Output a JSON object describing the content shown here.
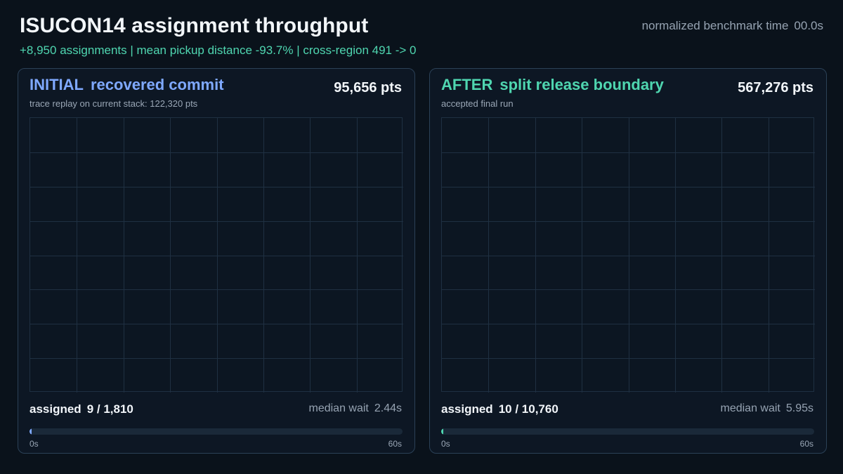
{
  "header": {
    "title": "ISUCON14 assignment throughput",
    "summary": "+8,950 assignments  |  mean pickup distance -93.7%  |  cross-region 491 -> 0",
    "bench_label": "normalized benchmark time",
    "bench_value": "00.0s"
  },
  "panels": {
    "initial": {
      "tag": "INITIAL",
      "name": "recovered commit",
      "subtitle": "trace replay on current stack: 122,320 pts",
      "score": "95,656 pts",
      "assigned_label": "assigned",
      "assigned_count": "9 / 1,810",
      "wait_label": "median wait",
      "wait_value": "2.44s",
      "progress": 0.006,
      "axis_start": "0s",
      "axis_end": "60s"
    },
    "after": {
      "tag": "AFTER",
      "name": "split release boundary",
      "subtitle": "accepted final run",
      "score": "567,276 pts",
      "assigned_label": "assigned",
      "assigned_count": "10 / 10,760",
      "wait_label": "median wait",
      "wait_value": "5.95s",
      "progress": 0.002,
      "axis_start": "0s",
      "axis_end": "60s"
    }
  },
  "colors": {
    "initial_accent": "#7fa9ff",
    "after_accent": "#4fd6b0",
    "background": "#0a121b"
  }
}
